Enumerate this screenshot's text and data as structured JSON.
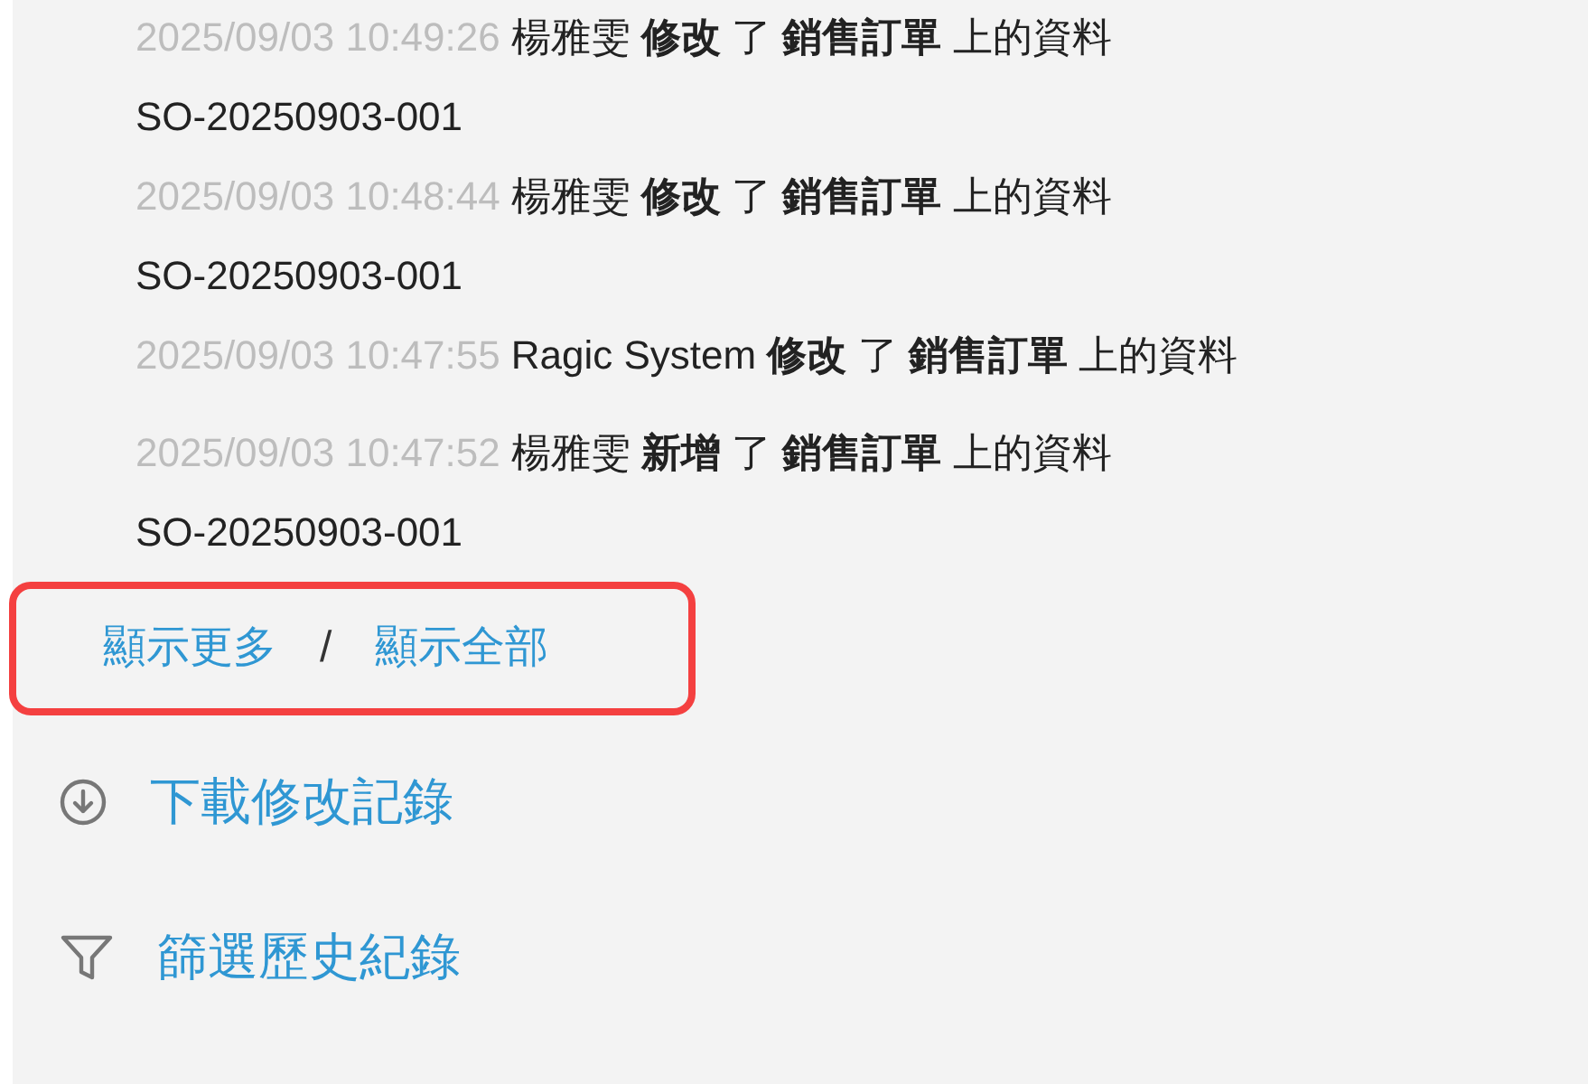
{
  "entries": [
    {
      "time": "2025/09/03 10:49:26",
      "text": "楊雅雯 **修改** 了 **銷售訂單** 上的資料",
      "record": "SO-20250903-001"
    },
    {
      "time": "2025/09/03 10:48:44",
      "text": "楊雅雯 **修改** 了 **銷售訂單** 上的資料",
      "record": "SO-20250903-001"
    },
    {
      "time": "2025/09/03 10:47:55",
      "text": "Ragic System **修改** 了 **銷售訂單** 上的資料"
    },
    {
      "time": "2025/09/03 10:47:52",
      "text": "楊雅雯 **新增** 了 **銷售訂單** 上的資料",
      "record": "SO-20250903-001"
    }
  ],
  "more_links": {
    "show_more": "顯示更多",
    "separator": "/",
    "show_all": "顯示全部"
  },
  "actions": [
    {
      "kind": "download",
      "label": "下載修改記錄"
    },
    {
      "kind": "filter",
      "label": "篩選歷史紀錄"
    }
  ]
}
